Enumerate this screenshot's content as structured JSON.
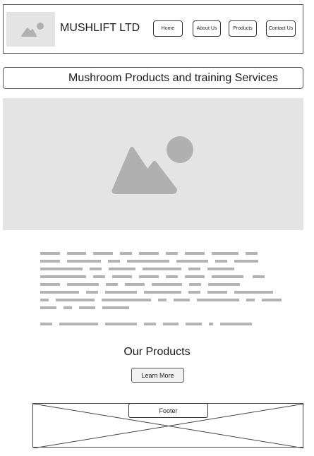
{
  "header": {
    "logo_icon": "image-placeholder-icon",
    "brand": "MUSHLIFT LTD",
    "nav": [
      "Home",
      "About Us",
      "Products",
      "Contact Us"
    ]
  },
  "title_bar": {
    "text": "Mushroom Products and training Services"
  },
  "hero": {
    "icon": "image-placeholder-icon"
  },
  "body_text": {
    "style": "placeholder-text-lines"
  },
  "products": {
    "heading": "Our Products",
    "button": "Learn More"
  },
  "footer": {
    "label": "Footer"
  },
  "colors": {
    "placeholder_fill": "#e4e4e4",
    "placeholder_icon": "#b0b0b0",
    "text_bar": "#b3b3b3"
  }
}
